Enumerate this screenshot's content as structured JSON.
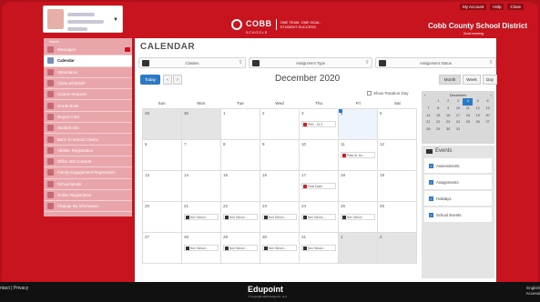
{
  "header": {
    "logo_name": "COBB",
    "logo_sub": "SCHOOLS",
    "logo_tagline_1": "ONE TEAM. ONE GOAL.",
    "logo_tagline_2": "STUDENT SUCCESS.",
    "links": [
      "My Account",
      "Help",
      "Close"
    ],
    "district": "Cobb County School District",
    "greeting": "Good morning"
  },
  "sidebar": {
    "home": "Home",
    "items": [
      {
        "label": "Messages",
        "name": "messages",
        "badge": true
      },
      {
        "label": "Calendar",
        "name": "calendar",
        "active": true
      },
      {
        "label": "Attendance",
        "name": "attendance"
      },
      {
        "label": "Class Schedule",
        "name": "class-schedule"
      },
      {
        "label": "Course Request",
        "name": "course-request"
      },
      {
        "label": "Grade Book",
        "name": "grade-book"
      },
      {
        "label": "Report Card",
        "name": "report-card"
      },
      {
        "label": "Student Info",
        "name": "student-info"
      },
      {
        "label": "Back To School Choice",
        "name": "back-to-school-choice"
      },
      {
        "label": "Athletic Registration",
        "name": "athletic-registration"
      },
      {
        "label": "Office 365 Consent",
        "name": "office-365-consent"
      },
      {
        "label": "Family Engagement Registration",
        "name": "family-engagement-registration"
      },
      {
        "label": "School Meals",
        "name": "school-meals"
      },
      {
        "label": "Online Registration",
        "name": "online-registration"
      },
      {
        "label": "Change My Information",
        "name": "change-my-information"
      }
    ]
  },
  "main": {
    "title": "CALENDAR",
    "filters": [
      "Classes",
      "Assignment Type",
      "Assignment Status"
    ],
    "today_label": "Today",
    "prev": "‹",
    "next": "›",
    "month_title": "December 2020",
    "views": [
      "Month",
      "Week",
      "Day"
    ],
    "rotation_label": "Show Rotation Day",
    "weekdays": [
      "Sun",
      "Mon",
      "Tue",
      "Wed",
      "Thu",
      "Fri",
      "Sat"
    ],
    "weeks": [
      [
        {
          "d": "29",
          "other": true
        },
        {
          "d": "30",
          "other": true
        },
        {
          "d": "1"
        },
        {
          "d": "2"
        },
        {
          "d": "3",
          "ev": {
            "type": "assign",
            "text": "PDD - 13.3"
          }
        },
        {
          "d": "4",
          "today": true
        },
        {
          "d": "5"
        }
      ],
      [
        {
          "d": "6"
        },
        {
          "d": "7"
        },
        {
          "d": "8"
        },
        {
          "d": "9"
        },
        {
          "d": "10"
        },
        {
          "d": "11",
          "ev": {
            "type": "assign",
            "text": "Pass Sr. Ho..."
          }
        },
        {
          "d": "12"
        }
      ],
      [
        {
          "d": "13"
        },
        {
          "d": "14"
        },
        {
          "d": "15"
        },
        {
          "d": "16"
        },
        {
          "d": "17",
          "ev": {
            "type": "assign",
            "text": "Final Exam"
          }
        },
        {
          "d": "18"
        },
        {
          "d": "19"
        }
      ],
      [
        {
          "d": "20"
        },
        {
          "d": "21",
          "ev": {
            "type": "holiday",
            "text": "Non School ..."
          }
        },
        {
          "d": "22",
          "ev": {
            "type": "holiday",
            "text": "Non School ..."
          }
        },
        {
          "d": "23",
          "ev": {
            "type": "holiday",
            "text": "Non School ..."
          }
        },
        {
          "d": "24",
          "ev": {
            "type": "holiday",
            "text": "Non School ..."
          }
        },
        {
          "d": "25",
          "ev": {
            "type": "holiday",
            "text": "Non School"
          }
        },
        {
          "d": "26"
        }
      ],
      [
        {
          "d": "27"
        },
        {
          "d": "28",
          "ev": {
            "type": "holiday",
            "text": "Non School ..."
          }
        },
        {
          "d": "29",
          "ev": {
            "type": "holiday",
            "text": "Non School ..."
          }
        },
        {
          "d": "30",
          "ev": {
            "type": "holiday",
            "text": "Non School ..."
          }
        },
        {
          "d": "31",
          "ev": {
            "type": "holiday",
            "text": "Non School ..."
          }
        },
        {
          "d": "1",
          "other": true
        },
        {
          "d": "2",
          "other": true
        }
      ]
    ]
  },
  "mini_calendar": {
    "month": "December",
    "prev": "‹",
    "next": "›",
    "days": [
      "",
      "1",
      "2",
      "3",
      "4",
      "5",
      "6",
      "7",
      "8",
      "9",
      "10",
      "11",
      "12",
      "13",
      "14",
      "15",
      "16",
      "17",
      "18",
      "19",
      "20",
      "21",
      "22",
      "23",
      "24",
      "25",
      "26",
      "27",
      "28",
      "29",
      "30",
      "31"
    ],
    "selected": "4"
  },
  "events": {
    "title": "Events",
    "items": [
      "Assessments",
      "Assignments",
      "Holidays",
      "School Events"
    ]
  },
  "footer": {
    "left": "ntact | Privacy",
    "logo": "Edupoint",
    "copyright": "© Copyright 2020 Edupoint, LLC",
    "right_1": "English",
    "right_2": "Accessi"
  }
}
